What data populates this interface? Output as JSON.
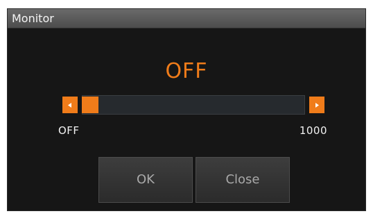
{
  "dialog": {
    "title": "Monitor",
    "value_display": "OFF",
    "slider": {
      "min_label": "OFF",
      "max_label": "1000",
      "level_fraction": 0,
      "accent_color": "#f07c1a"
    },
    "buttons": {
      "ok_label": "OK",
      "close_label": "Close"
    }
  },
  "icons": [
    "chevron-left-icon",
    "chevron-right-icon"
  ]
}
